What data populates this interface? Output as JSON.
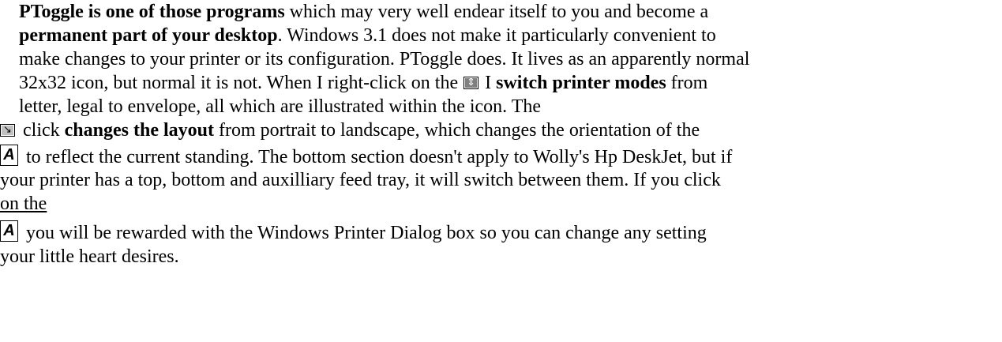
{
  "paragraph": {
    "l1_b1": "PToggle is one of those programs",
    "l1_t1": " which may very well endear itself to you and become a",
    "l2_b1": "permanent part of your desktop",
    "l2_t1": ". Windows 3.1 does not make it particularly convenient to",
    "l3_t1": "make changes to your printer or its configuration. PToggle does. It lives as an apparently normal",
    "l4_t1": "32x32 icon, but normal it is not. When I right-click on the ",
    "l4_t2": " I ",
    "l4_b1": "switch printer modes",
    "l4_t3": " from",
    "l5_t1": "letter, legal to envelope, all which are illustrated within the icon. The",
    "l6_t1": " click ",
    "l6_b1": "changes the layout",
    "l6_t2": " from portrait to landscape, which changes the orientation of the",
    "l7_t1": " to reflect the current standing. The bottom section doesn't apply to Wolly's Hp DeskJet, but if",
    "l8_t1": "your printer has a top, bottom and auxilliary feed tray, it will switch between them. If you click",
    "l9_t1": "on the",
    "l10_t1": " you will be rewarded with the Windows Printer Dialog box so you can change any setting",
    "l11_t1": "your little heart desires."
  },
  "icons": {
    "updown_glyph": "⇕",
    "rotate_glyph": "↘",
    "a_glyph": "A"
  }
}
